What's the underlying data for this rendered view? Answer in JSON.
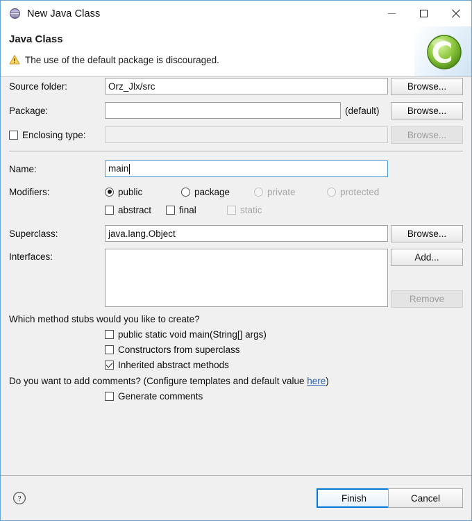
{
  "window": {
    "title": "New Java Class",
    "icon": "java-sphere-icon",
    "controls": {
      "minimize": "minimize-icon",
      "maximize": "maximize-icon",
      "close": "close-icon"
    }
  },
  "header": {
    "title": "Java Class",
    "message": "The use of the default package is discouraged.",
    "message_icon": "warning-icon",
    "banner_icon": "java-class-green-icon",
    "warning_color": "#f0a30a",
    "banner_color": "#7ac143"
  },
  "form": {
    "source_folder": {
      "label": "Source folder:",
      "value": "Orz_Jlx/src",
      "browse_label": "Browse...",
      "enabled": true
    },
    "package": {
      "label": "Package:",
      "value": "",
      "suffix": "(default)",
      "browse_label": "Browse...",
      "enabled": true
    },
    "enclosing_type": {
      "label": "Enclosing type:",
      "checked": false,
      "value": "",
      "browse_label": "Browse...",
      "enabled": false
    },
    "name": {
      "label": "Name:",
      "value": "main",
      "focused": true
    },
    "modifiers": {
      "label": "Modifiers:",
      "access": [
        {
          "label": "public",
          "selected": true,
          "enabled": true
        },
        {
          "label": "package",
          "selected": false,
          "enabled": true
        },
        {
          "label": "private",
          "selected": false,
          "enabled": false
        },
        {
          "label": "protected",
          "selected": false,
          "enabled": false
        }
      ],
      "flags": [
        {
          "label": "abstract",
          "checked": false,
          "enabled": true
        },
        {
          "label": "final",
          "checked": false,
          "enabled": true
        },
        {
          "label": "static",
          "checked": false,
          "enabled": false
        }
      ]
    },
    "superclass": {
      "label": "Superclass:",
      "value": "java.lang.Object",
      "browse_label": "Browse..."
    },
    "interfaces": {
      "label": "Interfaces:",
      "items": [],
      "add_label": "Add...",
      "remove_label": "Remove",
      "remove_enabled": false
    }
  },
  "stubs": {
    "question": "Which method stubs would you like to create?",
    "options": [
      {
        "label": "public static void main(String[] args)",
        "checked": false
      },
      {
        "label": "Constructors from superclass",
        "checked": false
      },
      {
        "label": "Inherited abstract methods",
        "checked": true
      }
    ]
  },
  "comments": {
    "question_prefix": "Do you want to add comments? (Configure templates and default value ",
    "link_label": "here",
    "question_suffix": ")",
    "option": {
      "label": "Generate comments",
      "checked": false
    }
  },
  "footer": {
    "help_icon": "help-question-icon",
    "finish_label": "Finish",
    "cancel_label": "Cancel"
  }
}
